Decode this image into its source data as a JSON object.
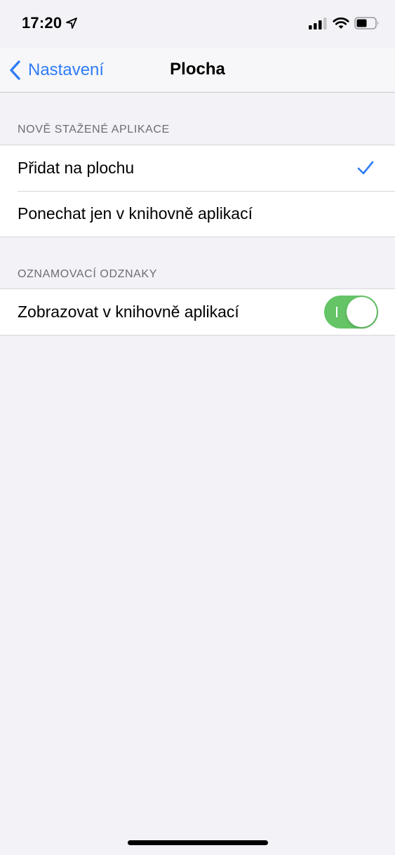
{
  "status_bar": {
    "time": "17:20",
    "icons": [
      "location-icon",
      "signal-icon",
      "wifi-icon",
      "battery-icon"
    ]
  },
  "nav": {
    "back_label": "Nastavení",
    "title": "Plocha",
    "back_icon": "chevron-left-icon"
  },
  "sections": [
    {
      "header": "NOVĚ STAŽENÉ APLIKACE",
      "options": [
        {
          "label": "Přidat na plochu",
          "selected": true
        },
        {
          "label": "Ponechat jen v knihovně aplikací",
          "selected": false
        }
      ]
    },
    {
      "header": "OZNAMOVACÍ ODZNAKY",
      "options": [
        {
          "label": "Zobrazovat v knihovně aplikací",
          "toggle_on": true
        }
      ]
    }
  ],
  "colors": {
    "accent": "#2f7cf6",
    "toggle_on": "#65c466",
    "background": "#f2f2f7",
    "header_text": "#6d6d72"
  }
}
